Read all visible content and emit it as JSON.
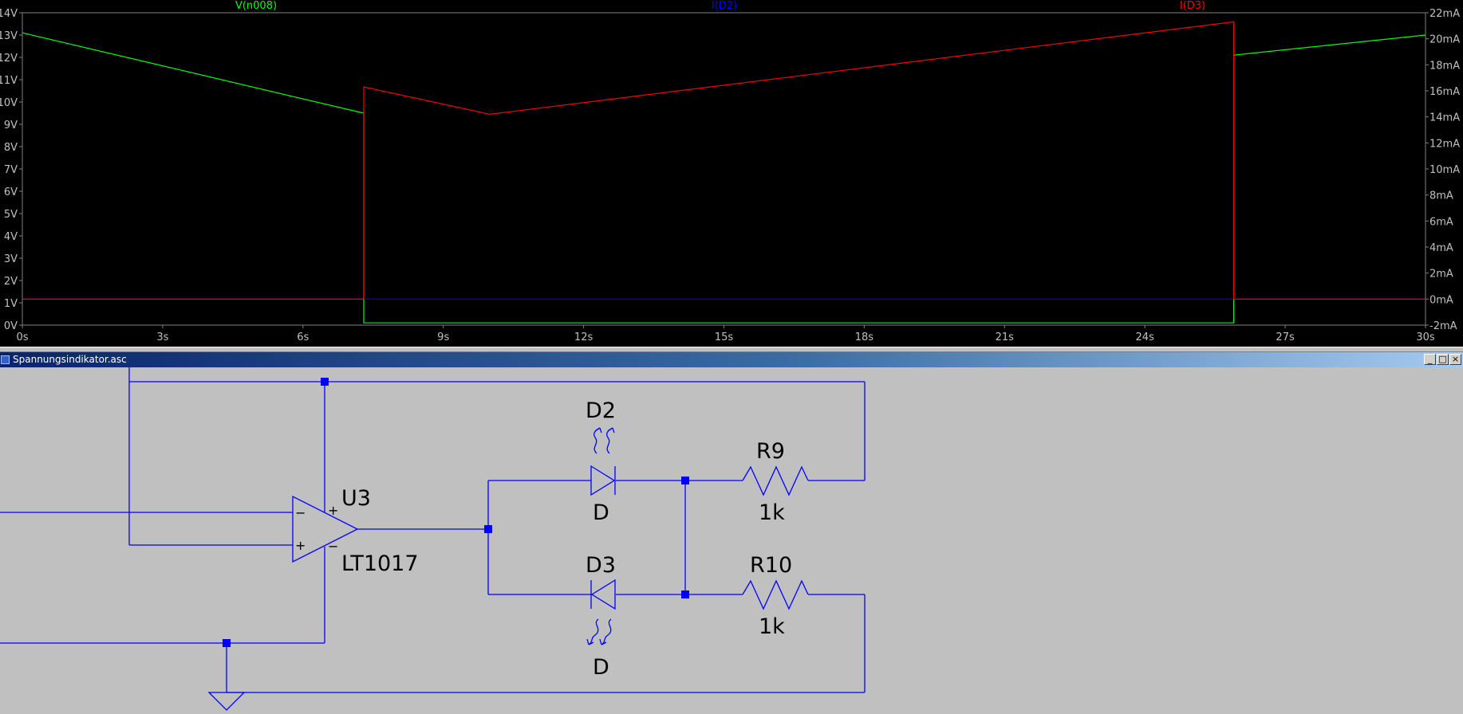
{
  "colors": {
    "v_n008": "#00ff00",
    "i_d2": "#0000ff",
    "i_d3": "#ff0000",
    "axis_text": "#c0c0c0",
    "plot_bg": "#000000",
    "wire": "#0000ff",
    "junction": "#0000ff",
    "schematic_bg": "#c0c0c0"
  },
  "chart_data": {
    "type": "line",
    "x": {
      "label": "",
      "unit": "s",
      "range": [
        0,
        30
      ],
      "ticks": [
        "0s",
        "3s",
        "6s",
        "9s",
        "12s",
        "15s",
        "18s",
        "21s",
        "24s",
        "27s",
        "30s"
      ]
    },
    "y_left": {
      "unit": "V",
      "range": [
        0,
        14
      ],
      "ticks": [
        "0V",
        "1V",
        "2V",
        "3V",
        "4V",
        "5V",
        "6V",
        "7V",
        "8V",
        "9V",
        "10V",
        "11V",
        "12V",
        "13V",
        "14V"
      ]
    },
    "y_right": {
      "unit": "A",
      "range": [
        -0.002,
        0.022
      ],
      "ticks": [
        "-2mA",
        "0mA",
        "2mA",
        "4mA",
        "6mA",
        "8mA",
        "10mA",
        "12mA",
        "14mA",
        "16mA",
        "18mA",
        "20mA",
        "22mA"
      ]
    },
    "grid": false,
    "legend_position": "top",
    "series": [
      {
        "name": "V(n008)",
        "axis": "left",
        "color_key": "v_n008",
        "x": [
          0,
          7.3,
          7.3,
          25.9,
          25.9,
          30
        ],
        "y": [
          13.1,
          9.5,
          0.1,
          0.1,
          12.1,
          13.0
        ]
      },
      {
        "name": "I(D2)",
        "axis": "right",
        "color_key": "i_d2",
        "x": [
          0,
          30
        ],
        "y": [
          0.0,
          0.0
        ]
      },
      {
        "name": "I(D3)",
        "axis": "right",
        "color_key": "i_d3",
        "x": [
          0,
          7.3,
          7.3,
          10.0,
          25.9,
          25.9,
          30
        ],
        "y": [
          0.0,
          0.0,
          0.0163,
          0.0142,
          0.0213,
          0.0,
          0.0
        ]
      }
    ]
  },
  "window": {
    "title": "Spannungsindikator.asc",
    "minimize_glyph": "_",
    "maximize_glyph": "□",
    "close_glyph": "×"
  },
  "schematic": {
    "opamp_ref": "U3",
    "opamp_value": "LT1017",
    "opamp_minus_sign": "−",
    "opamp_plus_sign": "+",
    "d2_ref": "D2",
    "d2_value": "D",
    "d3_ref": "D3",
    "d3_value": "D",
    "r9_ref": "R9",
    "r9_value": "1k",
    "r10_ref": "R10",
    "r10_value": "1k"
  }
}
